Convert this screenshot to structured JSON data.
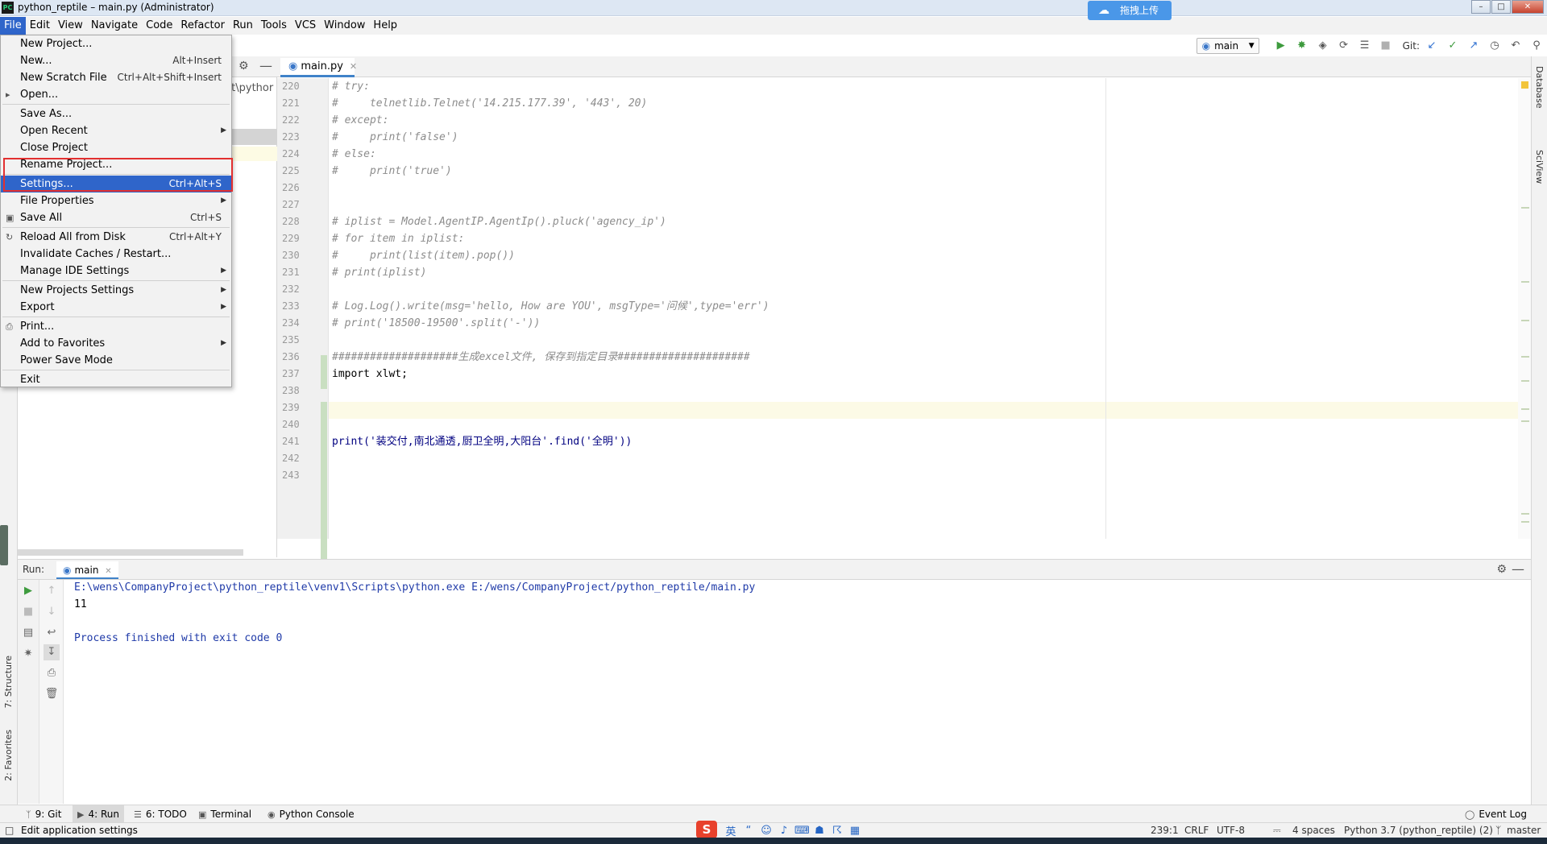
{
  "window": {
    "title": "python_reptile – main.py (Administrator)",
    "app_icon_text": "PC",
    "upload_label": "拖拽上传"
  },
  "menubar": {
    "items": [
      "File",
      "Edit",
      "View",
      "Navigate",
      "Code",
      "Refactor",
      "Run",
      "Tools",
      "VCS",
      "Window",
      "Help"
    ]
  },
  "toolbar": {
    "run_config": "main",
    "git_label": "Git:"
  },
  "file_menu": {
    "items": [
      {
        "label": "New Project...",
        "shortcut": "",
        "submenu": false
      },
      {
        "label": "New...",
        "shortcut": "Alt+Insert",
        "submenu": false
      },
      {
        "label": "New Scratch File",
        "shortcut": "Ctrl+Alt+Shift+Insert",
        "submenu": false
      },
      {
        "label": "Open...",
        "shortcut": "",
        "submenu": false
      },
      {
        "label": "Save As...",
        "shortcut": "",
        "submenu": false
      },
      {
        "label": "Open Recent",
        "shortcut": "",
        "submenu": true
      },
      {
        "label": "Close Project",
        "shortcut": "",
        "submenu": false
      },
      {
        "label": "Rename Project...",
        "shortcut": "",
        "submenu": false
      },
      {
        "label": "Settings...",
        "shortcut": "Ctrl+Alt+S",
        "submenu": false,
        "selected": true
      },
      {
        "label": "File Properties",
        "shortcut": "",
        "submenu": true
      },
      {
        "label": "Save All",
        "shortcut": "Ctrl+S",
        "submenu": false
      },
      {
        "label": "Reload All from Disk",
        "shortcut": "Ctrl+Alt+Y",
        "submenu": false
      },
      {
        "label": "Invalidate Caches / Restart...",
        "shortcut": "",
        "submenu": false
      },
      {
        "label": "Manage IDE Settings",
        "shortcut": "",
        "submenu": true
      },
      {
        "label": "New Projects Settings",
        "shortcut": "",
        "submenu": true
      },
      {
        "label": "Export",
        "shortcut": "",
        "submenu": true
      },
      {
        "label": "Print...",
        "shortcut": "",
        "submenu": false
      },
      {
        "label": "Add to Favorites",
        "shortcut": "",
        "submenu": true
      },
      {
        "label": "Power Save Mode",
        "shortcut": "",
        "submenu": false
      },
      {
        "label": "Exit",
        "shortcut": "",
        "submenu": false
      }
    ]
  },
  "project_panel": {
    "path_fragment": "ect\\pythor"
  },
  "editor": {
    "tab_label": "main.py",
    "lines": [
      {
        "num": "220",
        "text": "# try:",
        "style": "cmt"
      },
      {
        "num": "221",
        "text": "#     telnetlib.Telnet('14.215.177.39', '443', 20)",
        "style": "cmt"
      },
      {
        "num": "222",
        "text": "# except:",
        "style": "cmt"
      },
      {
        "num": "223",
        "text": "#     print('false')",
        "style": "cmt"
      },
      {
        "num": "224",
        "text": "# else:",
        "style": "cmt"
      },
      {
        "num": "225",
        "text": "#     print('true')",
        "style": "cmt"
      },
      {
        "num": "226",
        "text": "",
        "style": "cmt"
      },
      {
        "num": "227",
        "text": "",
        "style": "cmt"
      },
      {
        "num": "228",
        "text": "# iplist = Model.AgentIP.AgentIp().pluck('agency_ip')",
        "style": "cmt"
      },
      {
        "num": "229",
        "text": "# for item in iplist:",
        "style": "cmt"
      },
      {
        "num": "230",
        "text": "#     print(list(item).pop())",
        "style": "cmt"
      },
      {
        "num": "231",
        "text": "# print(iplist)",
        "style": "cmt"
      },
      {
        "num": "232",
        "text": "",
        "style": "cmt"
      },
      {
        "num": "233",
        "text": "# Log.Log().write(msg='hello, How are YOU', msgType='问候',type='err')",
        "style": "cmt"
      },
      {
        "num": "234",
        "text": "# print('18500-19500'.split('-'))",
        "style": "cmt"
      },
      {
        "num": "235",
        "text": "",
        "style": "cmt"
      },
      {
        "num": "236",
        "text": "####################生成excel文件, 保存到指定目录#####################",
        "style": "hdrcmt"
      },
      {
        "num": "237",
        "text": "import xlwt;",
        "style": "plain"
      },
      {
        "num": "238",
        "text": "",
        "style": "plain"
      },
      {
        "num": "239",
        "text": "",
        "style": "plain"
      },
      {
        "num": "240",
        "text": "",
        "style": "plain"
      },
      {
        "num": "241",
        "text": "print('装交付,南北通透,厨卫全明,大阳台'.find('全明'))",
        "style": "kw"
      },
      {
        "num": "242",
        "text": "",
        "style": "plain"
      },
      {
        "num": "243",
        "text": "",
        "style": "plain"
      }
    ]
  },
  "run_panel": {
    "label": "Run:",
    "tab": "main",
    "output": [
      {
        "text": "E:\\wens\\CompanyProject\\python_reptile\\venv1\\Scripts\\python.exe E:/wens/CompanyProject/python_reptile/main.py",
        "color": "blue"
      },
      {
        "text": "11",
        "color": "black"
      },
      {
        "text": "",
        "color": "black"
      },
      {
        "text": "Process finished with exit code 0",
        "color": "blue"
      }
    ]
  },
  "side_tools": {
    "right": [
      "Database",
      "SciView"
    ],
    "left": [
      "7: Structure",
      "2: Favorites"
    ]
  },
  "bottom_tabs": [
    {
      "label": "9: Git",
      "active": false
    },
    {
      "label": "4: Run",
      "active": true
    },
    {
      "label": "6: TODO",
      "active": false
    },
    {
      "label": "Terminal",
      "active": false
    },
    {
      "label": "Python Console",
      "active": false
    }
  ],
  "event_log": "Event Log",
  "statusbar": {
    "message": "Edit application settings",
    "ime_text": "英",
    "position": "239:1",
    "line_sep": "CRLF",
    "encoding": "UTF-8",
    "indent": "4 spaces",
    "interpreter": "Python 3.7 (python_reptile) (2)",
    "branch": "master"
  }
}
